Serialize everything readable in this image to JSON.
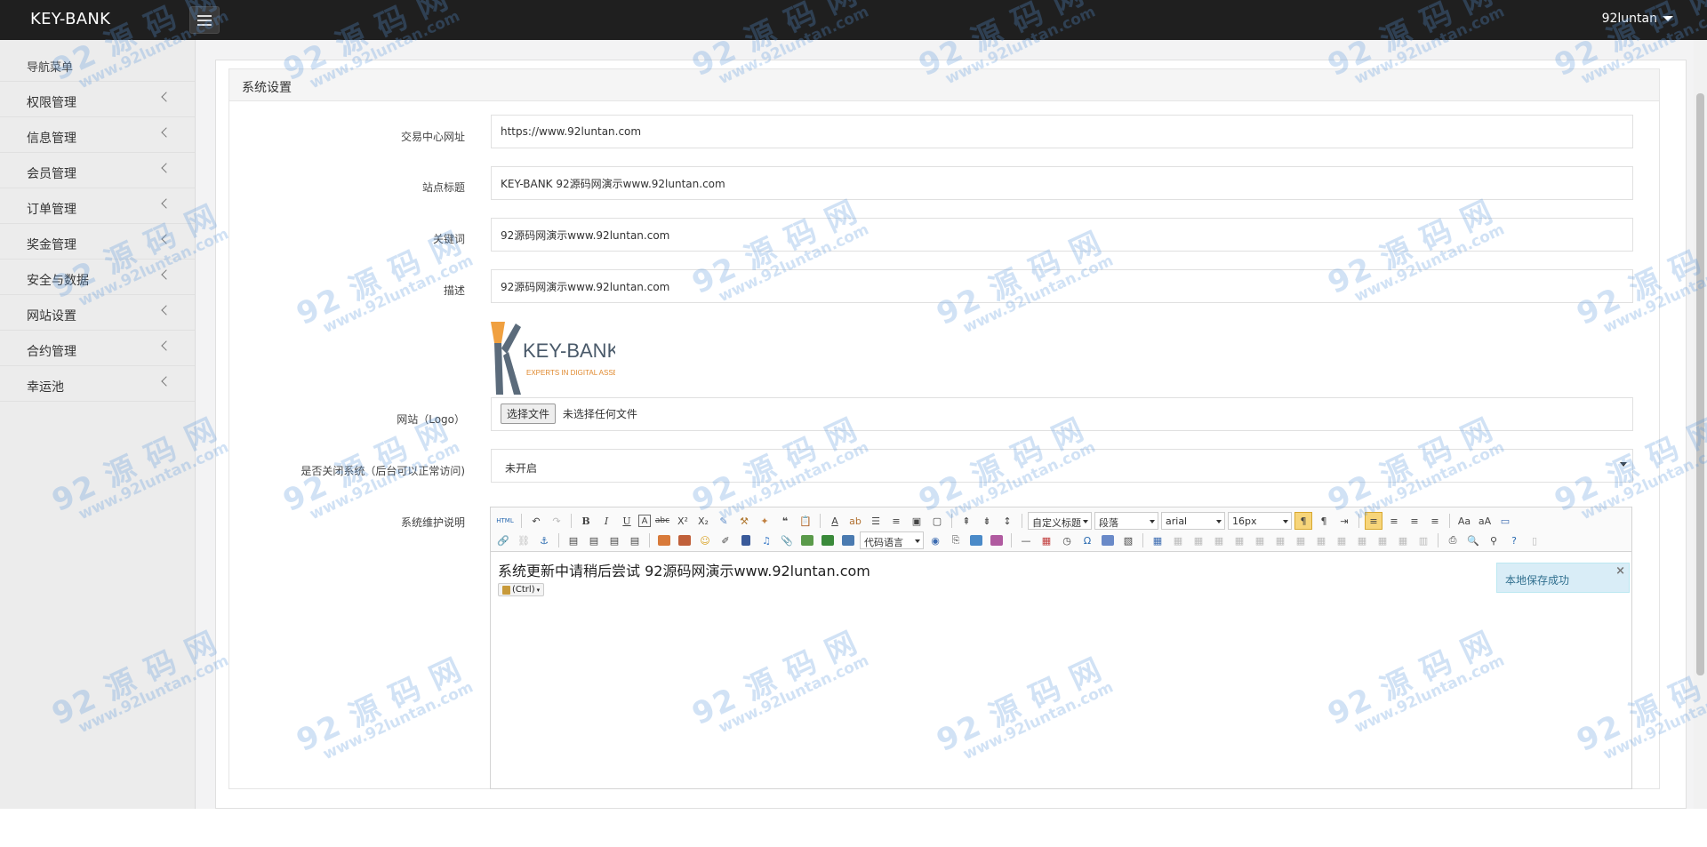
{
  "topbar": {
    "brand": "KEY-BANK",
    "user": "92luntan"
  },
  "sidebar": {
    "header": "导航菜单",
    "items": [
      {
        "label": "权限管理"
      },
      {
        "label": "信息管理"
      },
      {
        "label": "会员管理"
      },
      {
        "label": "订单管理"
      },
      {
        "label": "奖金管理"
      },
      {
        "label": "安全与数据"
      },
      {
        "label": "网站设置"
      },
      {
        "label": "合约管理"
      },
      {
        "label": "幸运池"
      }
    ]
  },
  "panel": {
    "title": "系统设置"
  },
  "form": {
    "exchange_url_label": "交易中心网址",
    "exchange_url_value": "https://www.92luntan.com",
    "site_title_label": "站点标题",
    "site_title_value": "KEY-BANK 92源码网演示www.92luntan.com",
    "keywords_label": "关键词",
    "keywords_value": "92源码网演示www.92luntan.com",
    "description_label": "描述",
    "description_value": "92源码网演示www.92luntan.com",
    "logo_label": "网站（Logo）",
    "logo_text": "KEY-BANK",
    "logo_tagline": "EXPERTS IN DIGITAL ASSETS",
    "file_button": "选择文件",
    "file_status": "未选择任何文件",
    "close_system_label": "是否关闭系统（后台可以正常访问)",
    "close_system_value": "未开启",
    "maintenance_label": "系统维护说明"
  },
  "editor": {
    "toolbar": {
      "html_label": "HTML",
      "format_combo": "自定义标题",
      "paragraph_combo": "段落",
      "font_combo": "arial",
      "size_combo": "16px",
      "code_combo": "代码语言"
    },
    "content": "系统更新中请稍后尝试 92源码网演示www.92luntan.com",
    "paste_hint": "(Ctrl)"
  },
  "toast": {
    "message": "本地保存成功",
    "close": "×"
  },
  "watermark": {
    "line1": "92 源 码 网",
    "line2": "www.92luntan.com"
  },
  "colors": {
    "topbar": "#1f1f1f",
    "sidebar": "#ececec",
    "toast_bg": "#d9edf7",
    "watermark": "#5a96dc"
  }
}
